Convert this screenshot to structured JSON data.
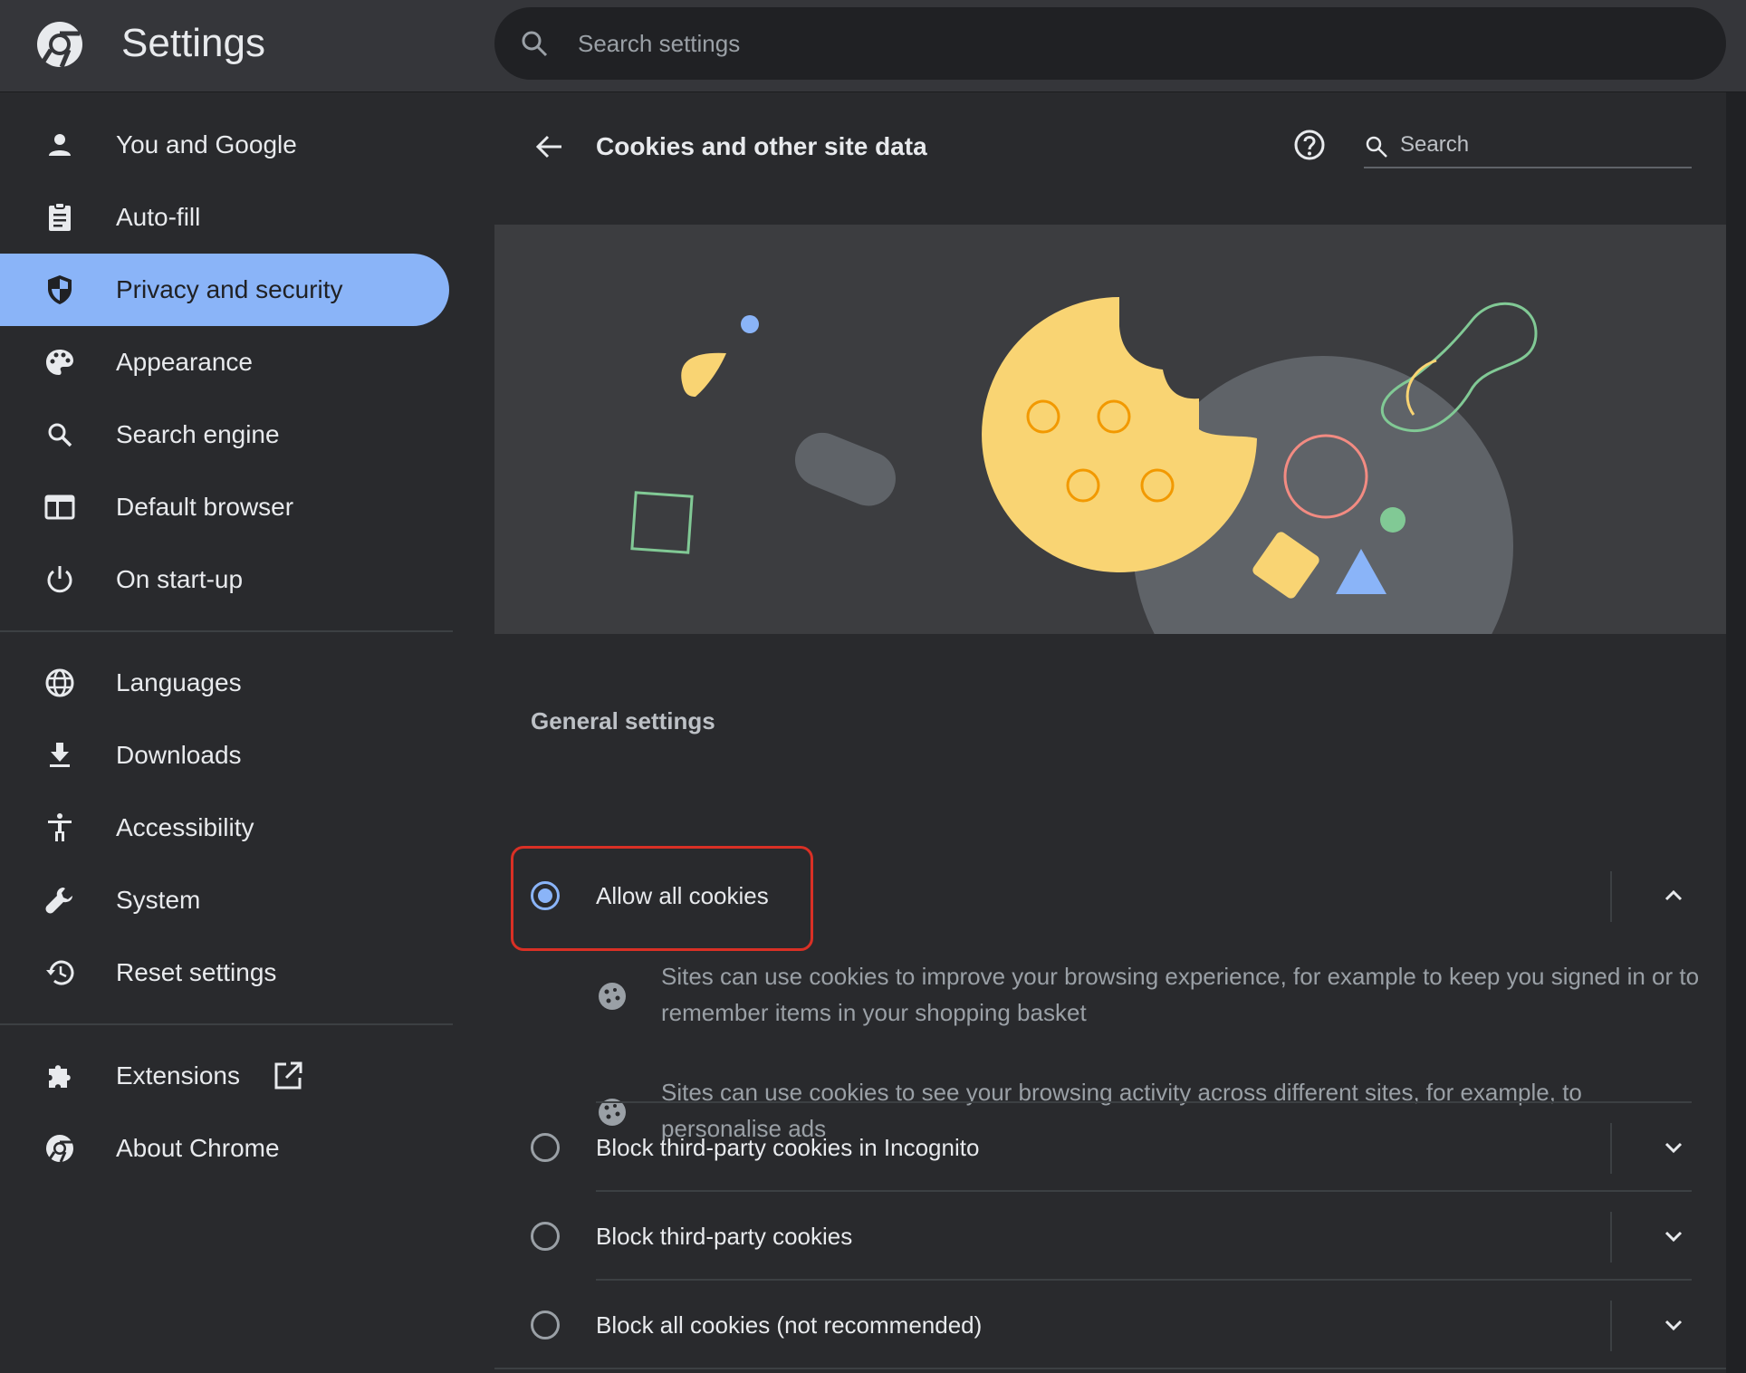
{
  "header": {
    "title": "Settings",
    "search_placeholder": "Search settings"
  },
  "sidebar": {
    "items": [
      {
        "label": "You and Google",
        "icon": "person-icon"
      },
      {
        "label": "Auto-fill",
        "icon": "clipboard-icon"
      },
      {
        "label": "Privacy and security",
        "icon": "shield-icon",
        "active": true
      },
      {
        "label": "Appearance",
        "icon": "palette-icon"
      },
      {
        "label": "Search engine",
        "icon": "search-icon"
      },
      {
        "label": "Default browser",
        "icon": "browser-icon"
      },
      {
        "label": "On start-up",
        "icon": "power-icon"
      },
      {
        "label": "Languages",
        "icon": "globe-icon"
      },
      {
        "label": "Downloads",
        "icon": "download-icon"
      },
      {
        "label": "Accessibility",
        "icon": "accessibility-icon"
      },
      {
        "label": "System",
        "icon": "wrench-icon"
      },
      {
        "label": "Reset settings",
        "icon": "history-icon"
      },
      {
        "label": "Extensions",
        "icon": "puzzle-icon"
      },
      {
        "label": "About Chrome",
        "icon": "chrome-icon"
      }
    ]
  },
  "page": {
    "title": "Cookies and other site data",
    "search_placeholder": "Search",
    "section_label": "General settings",
    "options": [
      {
        "label": "Allow all cookies",
        "selected": true,
        "expanded": true,
        "details": [
          "Sites can use cookies to improve your browsing experience, for example to keep you signed in or to remember items in your shopping basket",
          "Sites can use cookies to see your browsing activity across different sites, for example, to personalise ads"
        ]
      },
      {
        "label": "Block third-party cookies in Incognito",
        "selected": false,
        "expanded": false
      },
      {
        "label": "Block third-party cookies",
        "selected": false,
        "expanded": false
      },
      {
        "label": "Block all cookies (not recommended)",
        "selected": false,
        "expanded": false
      }
    ]
  },
  "colors": {
    "accent": "#8ab4f8",
    "highlight": "#d93025",
    "cookie": "#f9d473"
  }
}
